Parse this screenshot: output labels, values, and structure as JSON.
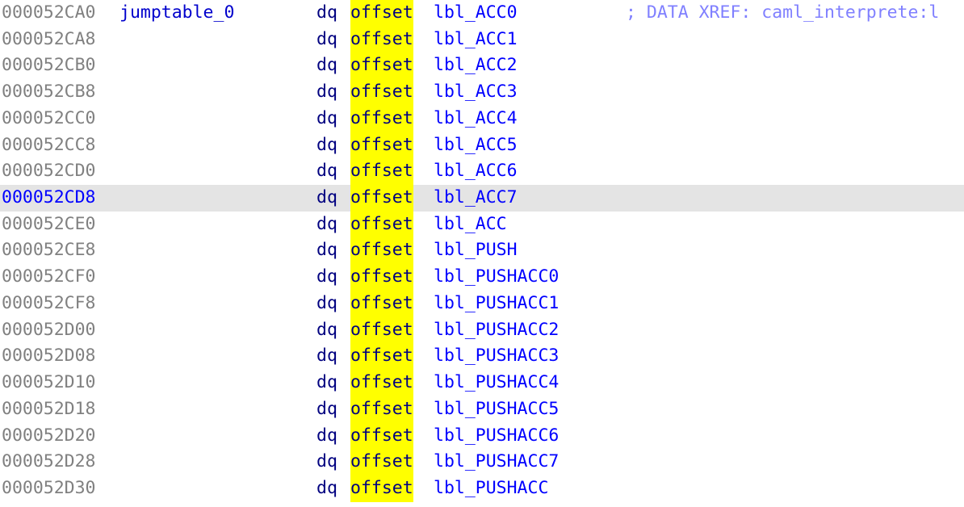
{
  "view": {
    "title": "IDA View-A",
    "background": "#ffffff",
    "current_line_background": "#e4e4e4",
    "highlight_color": "#ffff00",
    "address_color": "#808080",
    "current_address_color": "#0000ff",
    "mnemonic_color": "#000080",
    "operand_color": "#0000ff",
    "comment_color": "#8080ff",
    "name_color": "#0000cc"
  },
  "lines": [
    {
      "address": "000052CA0",
      "name": "jumptable_0",
      "mnemonic": "dq",
      "keyword": "offset",
      "operand": "lbl_ACC0",
      "comment": "; DATA XREF: caml_interprete:l",
      "current": false
    },
    {
      "address": "000052CA8",
      "name": "",
      "mnemonic": "dq",
      "keyword": "offset",
      "operand": "lbl_ACC1",
      "comment": "",
      "current": false
    },
    {
      "address": "000052CB0",
      "name": "",
      "mnemonic": "dq",
      "keyword": "offset",
      "operand": "lbl_ACC2",
      "comment": "",
      "current": false
    },
    {
      "address": "000052CB8",
      "name": "",
      "mnemonic": "dq",
      "keyword": "offset",
      "operand": "lbl_ACC3",
      "comment": "",
      "current": false
    },
    {
      "address": "000052CC0",
      "name": "",
      "mnemonic": "dq",
      "keyword": "offset",
      "operand": "lbl_ACC4",
      "comment": "",
      "current": false
    },
    {
      "address": "000052CC8",
      "name": "",
      "mnemonic": "dq",
      "keyword": "offset",
      "operand": "lbl_ACC5",
      "comment": "",
      "current": false
    },
    {
      "address": "000052CD0",
      "name": "",
      "mnemonic": "dq",
      "keyword": "offset",
      "operand": "lbl_ACC6",
      "comment": "",
      "current": false
    },
    {
      "address": "000052CD8",
      "name": "",
      "mnemonic": "dq",
      "keyword": "offset",
      "operand": "lbl_ACC7",
      "comment": "",
      "current": true
    },
    {
      "address": "000052CE0",
      "name": "",
      "mnemonic": "dq",
      "keyword": "offset",
      "operand": "lbl_ACC",
      "comment": "",
      "current": false
    },
    {
      "address": "000052CE8",
      "name": "",
      "mnemonic": "dq",
      "keyword": "offset",
      "operand": "lbl_PUSH",
      "comment": "",
      "current": false
    },
    {
      "address": "000052CF0",
      "name": "",
      "mnemonic": "dq",
      "keyword": "offset",
      "operand": "lbl_PUSHACC0",
      "comment": "",
      "current": false
    },
    {
      "address": "000052CF8",
      "name": "",
      "mnemonic": "dq",
      "keyword": "offset",
      "operand": "lbl_PUSHACC1",
      "comment": "",
      "current": false
    },
    {
      "address": "000052D00",
      "name": "",
      "mnemonic": "dq",
      "keyword": "offset",
      "operand": "lbl_PUSHACC2",
      "comment": "",
      "current": false
    },
    {
      "address": "000052D08",
      "name": "",
      "mnemonic": "dq",
      "keyword": "offset",
      "operand": "lbl_PUSHACC3",
      "comment": "",
      "current": false
    },
    {
      "address": "000052D10",
      "name": "",
      "mnemonic": "dq",
      "keyword": "offset",
      "operand": "lbl_PUSHACC4",
      "comment": "",
      "current": false
    },
    {
      "address": "000052D18",
      "name": "",
      "mnemonic": "dq",
      "keyword": "offset",
      "operand": "lbl_PUSHACC5",
      "comment": "",
      "current": false
    },
    {
      "address": "000052D20",
      "name": "",
      "mnemonic": "dq",
      "keyword": "offset",
      "operand": "lbl_PUSHACC6",
      "comment": "",
      "current": false
    },
    {
      "address": "000052D28",
      "name": "",
      "mnemonic": "dq",
      "keyword": "offset",
      "operand": "lbl_PUSHACC7",
      "comment": "",
      "current": false
    },
    {
      "address": "000052D30",
      "name": "",
      "mnemonic": "dq",
      "keyword": "offset",
      "operand": "lbl_PUSHACC",
      "comment": "",
      "current": false
    }
  ]
}
